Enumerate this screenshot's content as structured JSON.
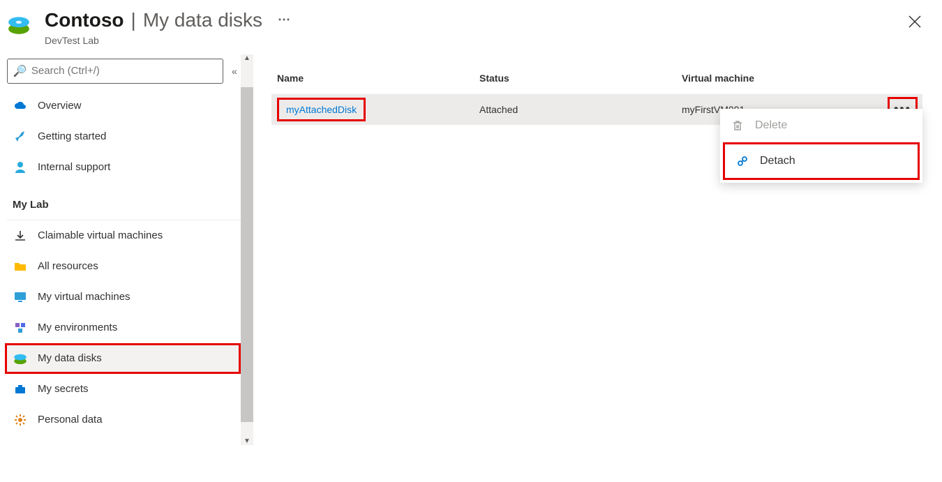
{
  "header": {
    "resource_name": "Contoso",
    "page_title": "My data disks",
    "resource_type": "DevTest Lab"
  },
  "search": {
    "placeholder": "Search (Ctrl+/)"
  },
  "sidebar": {
    "top": [
      {
        "key": "overview",
        "label": "Overview",
        "icon": "cloud"
      },
      {
        "key": "getting-started",
        "label": "Getting started",
        "icon": "rocket"
      },
      {
        "key": "internal-support",
        "label": "Internal support",
        "icon": "person"
      }
    ],
    "group_label": "My Lab",
    "lab": [
      {
        "key": "claimable-vms",
        "label": "Claimable virtual machines",
        "icon": "download"
      },
      {
        "key": "all-resources",
        "label": "All resources",
        "icon": "folder"
      },
      {
        "key": "my-vms",
        "label": "My virtual machines",
        "icon": "monitor"
      },
      {
        "key": "my-environments",
        "label": "My environments",
        "icon": "cubes"
      },
      {
        "key": "my-data-disks",
        "label": "My data disks",
        "icon": "disk",
        "selected": true,
        "highlighted": true
      },
      {
        "key": "my-secrets",
        "label": "My secrets",
        "icon": "briefcase"
      },
      {
        "key": "personal-data",
        "label": "Personal data",
        "icon": "gear"
      }
    ]
  },
  "table": {
    "columns": {
      "name": "Name",
      "status": "Status",
      "vm": "Virtual machine"
    },
    "rows": [
      {
        "name": "myAttachedDisk",
        "status": "Attached",
        "vm": "myFirstVM001"
      }
    ]
  },
  "context_menu": {
    "delete": "Delete",
    "detach": "Detach"
  }
}
